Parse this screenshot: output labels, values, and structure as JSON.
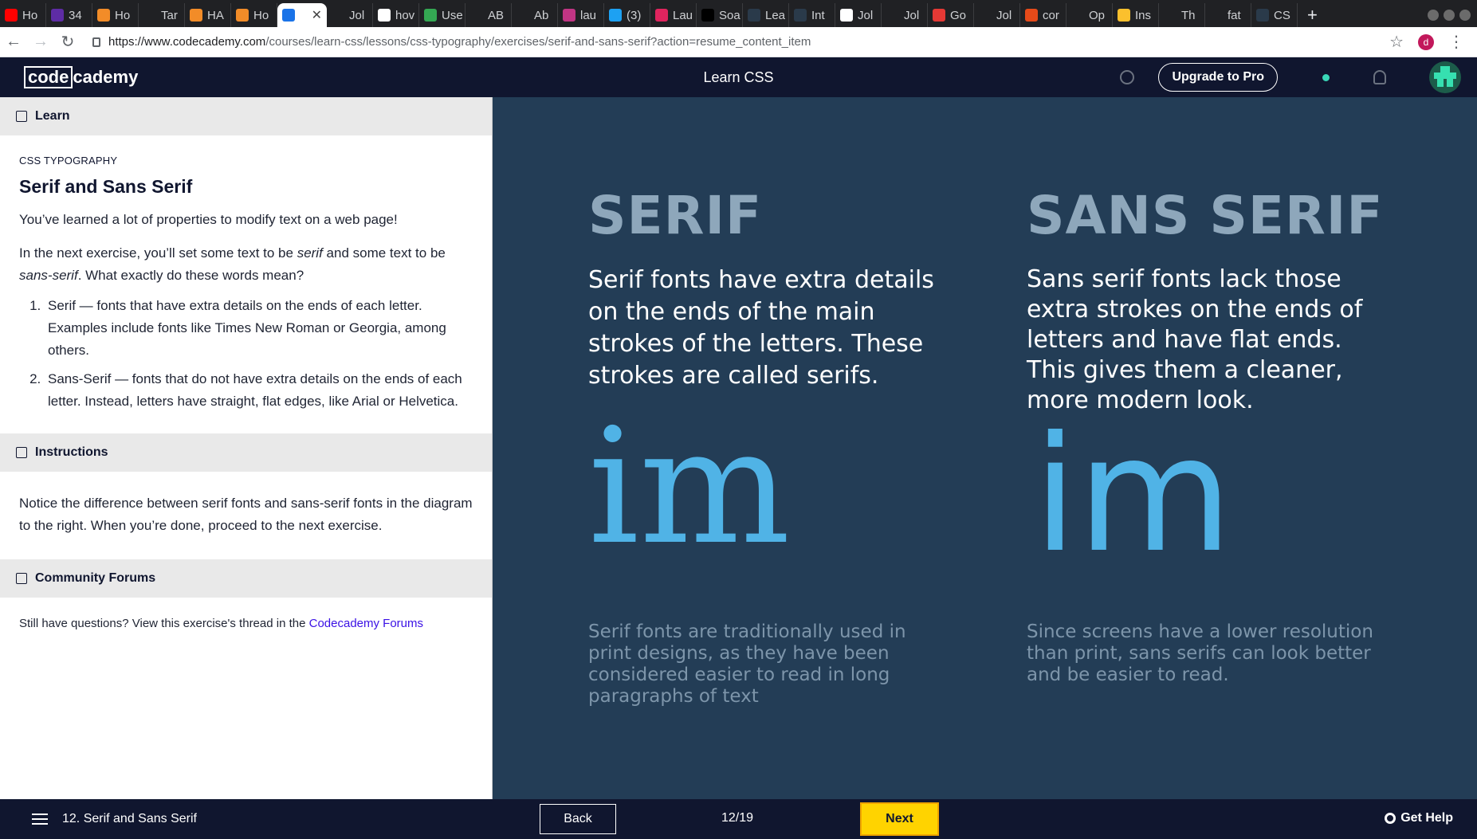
{
  "browser": {
    "tabs": [
      {
        "label": "Ho",
        "color": "#ff0000",
        "icon": "youtube-icon"
      },
      {
        "label": "34",
        "color": "#5e2ca5",
        "icon": "slack-icon"
      },
      {
        "label": "Ho",
        "color": "#f28c28",
        "icon": "fox-icon"
      },
      {
        "label": "Tar",
        "color": "#202124",
        "icon": "blank-icon"
      },
      {
        "label": "HA",
        "color": "#f28c28",
        "icon": "fox-icon"
      },
      {
        "label": "Ho",
        "color": "#f28c28",
        "icon": "fox-icon"
      },
      {
        "label": "",
        "color": "#1a73e8",
        "icon": "doc-icon",
        "active": true
      },
      {
        "label": "Jol",
        "color": "#202124",
        "icon": "blank-icon"
      },
      {
        "label": "hov",
        "color": "#ffffff",
        "icon": "google-icon"
      },
      {
        "label": "Use",
        "color": "#34a853",
        "icon": "clock-icon"
      },
      {
        "label": "AB",
        "color": "#202124",
        "icon": "github-icon"
      },
      {
        "label": "Ab",
        "color": "#202124",
        "icon": "blank-icon"
      },
      {
        "label": "lau",
        "color": "#c13584",
        "icon": "instagram-icon"
      },
      {
        "label": "(3)",
        "color": "#1da1f2",
        "icon": "twitter-icon"
      },
      {
        "label": "Lau",
        "color": "#e0245e",
        "icon": "umbrella-icon"
      },
      {
        "label": "Soa",
        "color": "#000000",
        "icon": "ds-icon"
      },
      {
        "label": "Lea",
        "color": "#2a3a4a",
        "icon": "blank-icon"
      },
      {
        "label": "Int",
        "color": "#2a3a4a",
        "icon": "blank-icon"
      },
      {
        "label": "Jol",
        "color": "#ffffff",
        "icon": "google-icon"
      },
      {
        "label": "Jol",
        "color": "#202124",
        "icon": "blank-icon"
      },
      {
        "label": "Go",
        "color": "#e53935",
        "icon": "f-icon"
      },
      {
        "label": "Jol",
        "color": "#202124",
        "icon": "blank-icon"
      },
      {
        "label": "cor",
        "color": "#e64a19",
        "icon": "ask-icon"
      },
      {
        "label": "Op",
        "color": "#202124",
        "icon": "github-icon"
      },
      {
        "label": "Ins",
        "color": "#fbc02d",
        "icon": "bulb-icon"
      },
      {
        "label": "Th",
        "color": "#202124",
        "icon": "github-icon"
      },
      {
        "label": "fat",
        "color": "#202124",
        "icon": "github-icon"
      },
      {
        "label": "CS",
        "color": "#2a3a4a",
        "icon": "blank-icon"
      }
    ],
    "new_tab": "+",
    "url_host": "https://www.codecademy.com",
    "url_path": "/courses/learn-css/lessons/css-typography/exercises/serif-and-sans-serif?action=resume_content_item",
    "profile_initial": "d"
  },
  "header": {
    "logo_boxed": "code",
    "logo_rest": "cademy",
    "course_title": "Learn CSS",
    "upgrade_label": "Upgrade to Pro"
  },
  "left": {
    "learn_heading": "Learn",
    "kicker": "CSS TYPOGRAPHY",
    "title": "Serif and Sans Serif",
    "p1": "You’ve learned a lot of properties to modify text on a web page!",
    "p2_a": "In the next exercise, you’ll set some text to be ",
    "p2_serif": "serif",
    "p2_b": " and some text to be ",
    "p2_sans": "sans-serif",
    "p2_c": ". What exactly do these words mean?",
    "list": [
      "Serif — fonts that have extra details on the ends of each letter. Examples include fonts like Times New Roman or Georgia, among others.",
      "Sans-Serif — fonts that do not have extra details on the ends of each letter. Instead, letters have straight, flat edges, like Arial or Helvetica."
    ],
    "instructions_heading": "Instructions",
    "instructions_text": "Notice the difference between serif fonts and sans-serif fonts in the diagram to the right. When you’re done, proceed to the next exercise.",
    "forums_heading": "Community Forums",
    "forums_text": "Still have questions? View this exercise's thread in the ",
    "forums_link": "Codecademy Forums"
  },
  "diagram": {
    "serif": {
      "heading": "SERIF",
      "description": "Serif fonts have extra details on the ends of the main strokes of the letters. These strokes are called serifs.",
      "sample": "im",
      "note": "Serif fonts are traditionally used in print designs, as they have been considered easier to read in long paragraphs of text"
    },
    "sans": {
      "heading": "SANS SERIF",
      "description": "Sans serif fonts lack those extra strokes on the ends of letters and have flat ends. This gives them a cleaner, more modern look.",
      "sample": "im",
      "note": "Since screens have a lower resolution than print, sans serifs can look better and be easier to read."
    }
  },
  "footer": {
    "lesson_name": "12. Serif and Sans Serif",
    "back_label": "Back",
    "progress": "12/19",
    "next_label": "Next",
    "help_label": "Get Help"
  },
  "colors": {
    "header_bg": "#10162f",
    "diagram_bg": "#233d56",
    "sample_glyph": "#50b3e6",
    "next_button": "#ffd300",
    "link": "#3a10e5"
  }
}
